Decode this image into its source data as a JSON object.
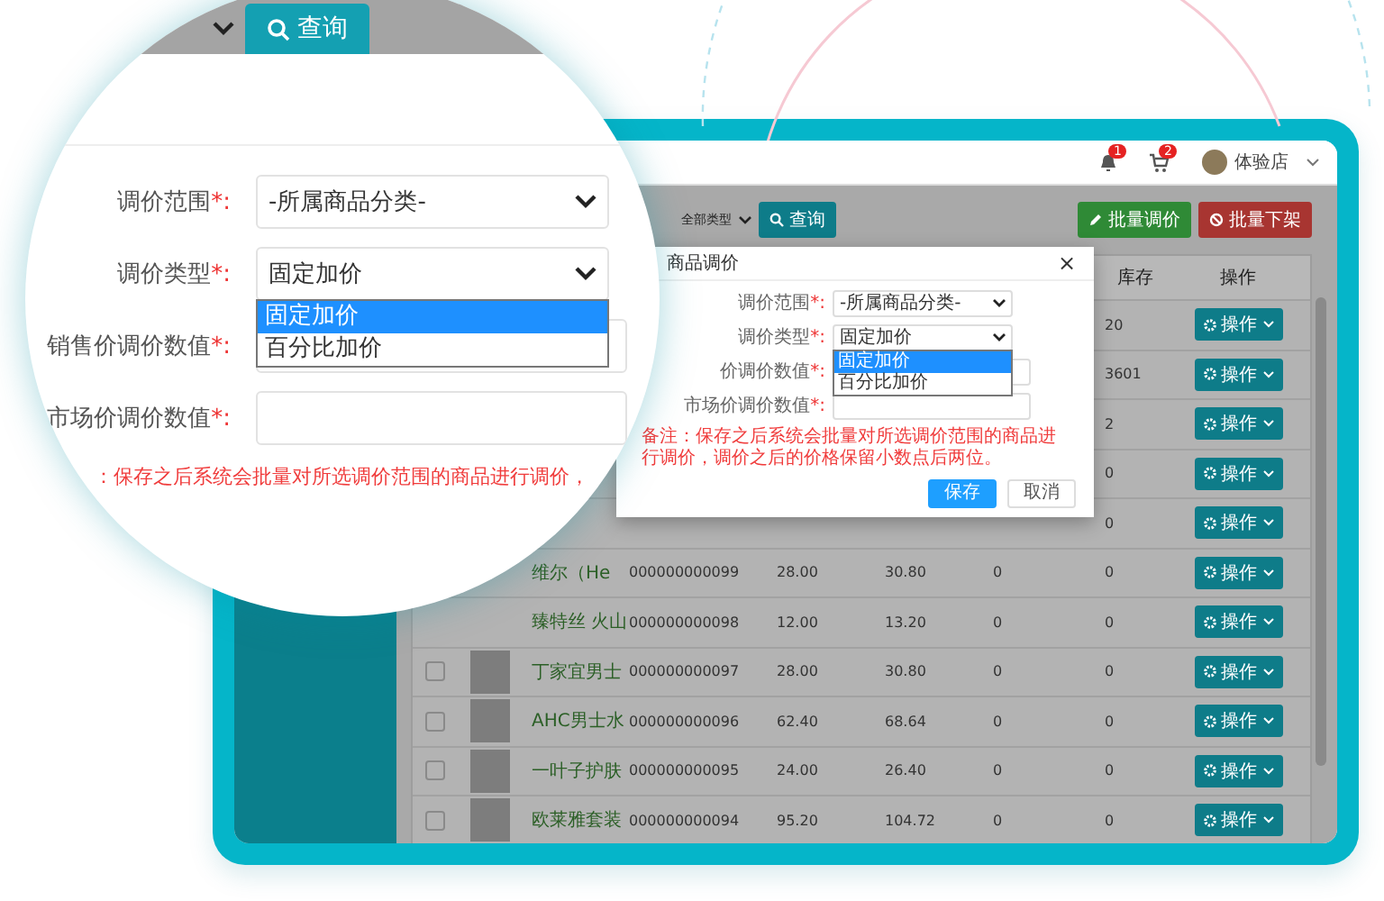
{
  "header": {
    "notification_badge": "1",
    "cart_badge": "2",
    "user": "体验店"
  },
  "toolbar": {
    "type_filter": "全部类型",
    "search_button": "查询",
    "actions": [
      {
        "label": "批量调价",
        "kind": "edit"
      },
      {
        "label": "批量下架",
        "kind": "delist"
      }
    ]
  },
  "table": {
    "columns": {
      "stock": "库存",
      "actions": "操作"
    },
    "rows": [
      {
        "stock": "20",
        "action": "操作"
      },
      {
        "stock": "3601",
        "action": "操作"
      },
      {
        "stock": "2",
        "action": "操作"
      },
      {
        "stock": "0",
        "action": "操作"
      },
      {
        "stock": "0",
        "action": "操作"
      },
      {
        "name": "维尔（He",
        "code": "000000000099",
        "price": "28.00",
        "market_price": "30.80",
        "column_7": "0",
        "stock": "0",
        "action": "操作"
      },
      {
        "name": "臻特丝 火山",
        "code": "000000000098",
        "price": "12.00",
        "market_price": "13.20",
        "column_7": "0",
        "stock": "0",
        "action": "操作"
      },
      {
        "checked": false,
        "name": "丁家宜男士",
        "code": "000000000097",
        "price": "28.00",
        "market_price": "30.80",
        "column_7": "0",
        "stock": "0",
        "action": "操作"
      },
      {
        "checked": false,
        "name": "AHC男士水",
        "code": "000000000096",
        "price": "62.40",
        "market_price": "68.64",
        "column_7": "0",
        "stock": "0",
        "action": "操作"
      },
      {
        "checked": false,
        "name": "一叶子护肤",
        "code": "000000000095",
        "price": "24.00",
        "market_price": "26.40",
        "column_7": "0",
        "stock": "0",
        "action": "操作"
      },
      {
        "checked": false,
        "name": "欧莱雅套装",
        "code": "000000000094",
        "price": "95.20",
        "market_price": "104.72",
        "column_7": "0",
        "stock": "0",
        "action": "操作"
      }
    ]
  },
  "modal": {
    "title": "商品调价",
    "close": "×",
    "fields": [
      {
        "label": "调价范围",
        "required_mark": "*:",
        "kind": "select",
        "value": "-所属商品分类-"
      },
      {
        "label": "调价类型",
        "required_mark": "*:",
        "kind": "select",
        "value": "固定加价",
        "expanded": true,
        "options": [
          {
            "label": "固定加价",
            "selected": true
          },
          {
            "label": "百分比加价",
            "selected": false
          }
        ]
      },
      {
        "label": "价调价数值",
        "required_mark": "*:",
        "kind": "input"
      },
      {
        "label": "市场价调价数值",
        "required_mark": "*:",
        "kind": "input"
      }
    ],
    "note": "备注：保存之后系统会批量对所选调价范围的商品进行调价，调价之后的价格保留小数点后两位。",
    "buttons": [
      {
        "label": "保存",
        "kind": "primary"
      },
      {
        "label": "取消",
        "kind": "default"
      }
    ]
  },
  "magnifier": {
    "search_button": "查询",
    "fields": [
      {
        "label": "调价范围",
        "required_mark": "*:",
        "kind": "select",
        "value": "-所属商品分类-"
      },
      {
        "label": "调价类型",
        "required_mark": "*:",
        "kind": "select",
        "value": "固定加价",
        "expanded": true,
        "options": [
          {
            "label": "固定加价",
            "selected": true
          },
          {
            "label": "百分比加价",
            "selected": false
          }
        ]
      },
      {
        "label": "销售价调价数值",
        "required_mark": "*:",
        "kind": "input"
      },
      {
        "label": "市场价调价数值",
        "required_mark": "*:",
        "kind": "input"
      }
    ],
    "note": "：保存之后系统会批量对所选调价范围的商品进行调价，"
  }
}
